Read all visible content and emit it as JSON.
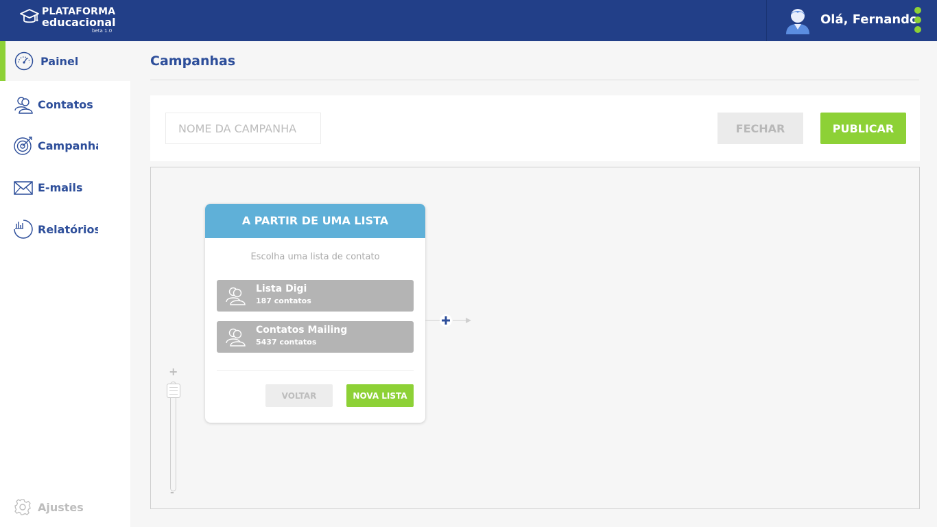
{
  "header": {
    "logo_line1": "PLATAFORMA",
    "logo_line2": "educacional",
    "logo_version": "beta 1.0",
    "greeting": "Olá, Fernando"
  },
  "sidebar": {
    "items": [
      {
        "label": "Painel",
        "icon": "speedometer-icon",
        "active": true
      },
      {
        "label": "Contatos",
        "icon": "contacts-icon",
        "active": false
      },
      {
        "label": "Campanhas",
        "icon": "target-icon",
        "active": false
      },
      {
        "label": "E-mails",
        "icon": "envelope-icon",
        "active": false
      },
      {
        "label": "Relatórios",
        "icon": "report-chart-icon",
        "active": false
      }
    ],
    "settings_label": "Ajustes"
  },
  "main": {
    "title": "Campanhas",
    "campaign_name_placeholder": "NOME DA CAMPANHA",
    "close_label": "FECHAR",
    "publish_label": "PUBLICAR"
  },
  "zoom": {
    "plus": "+",
    "minus": "-"
  },
  "card": {
    "title": "A PARTIR DE UMA LISTA",
    "subtitle": "Escolha uma lista de contato",
    "lists": [
      {
        "name": "Lista Digi",
        "count": "187 contatos"
      },
      {
        "name": "Contatos Mailing",
        "count": "5437 contatos"
      }
    ],
    "back_label": "VOLTAR",
    "new_list_label": "NOVA LISTA"
  },
  "colors": {
    "header_bg": "#223f88",
    "accent_green": "#8dd136",
    "card_header_blue": "#5fb0d8",
    "nav_text": "#2d4e9a"
  }
}
